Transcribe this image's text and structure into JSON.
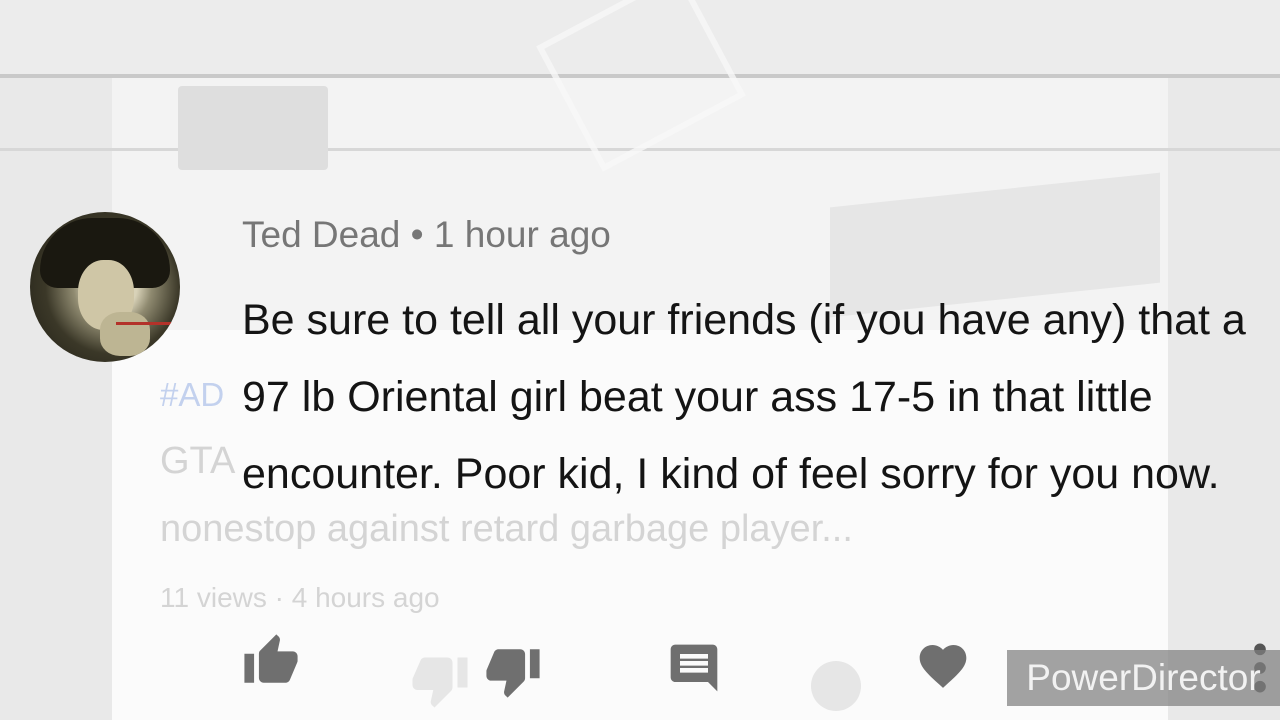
{
  "background": {
    "hashtag": "#AD",
    "line1": "GTA",
    "line2": "nonestop against retard garbage player...",
    "meta": "11 views · 4 hours ago"
  },
  "comment": {
    "author": "Ted Dead",
    "separator": "•",
    "time": "1 hour ago",
    "text": "Be sure to tell all your friends (if you have any) that a 97 lb Oriental girl beat  your ass 17-5 in that little encounter.  Poor kid, I kind of feel sorry for you now."
  },
  "actions": {
    "like_icon": "thumbs-up-icon",
    "dislike_icon": "thumbs-down-icon",
    "reply_icon": "reply-icon",
    "heart_icon": "heart-icon",
    "more_icon": "more-vertical-icon"
  },
  "watermark": {
    "text": "PowerDirector"
  },
  "colors": {
    "text": "#141414",
    "meta": "#767676",
    "icon": "#6f6f6f"
  }
}
